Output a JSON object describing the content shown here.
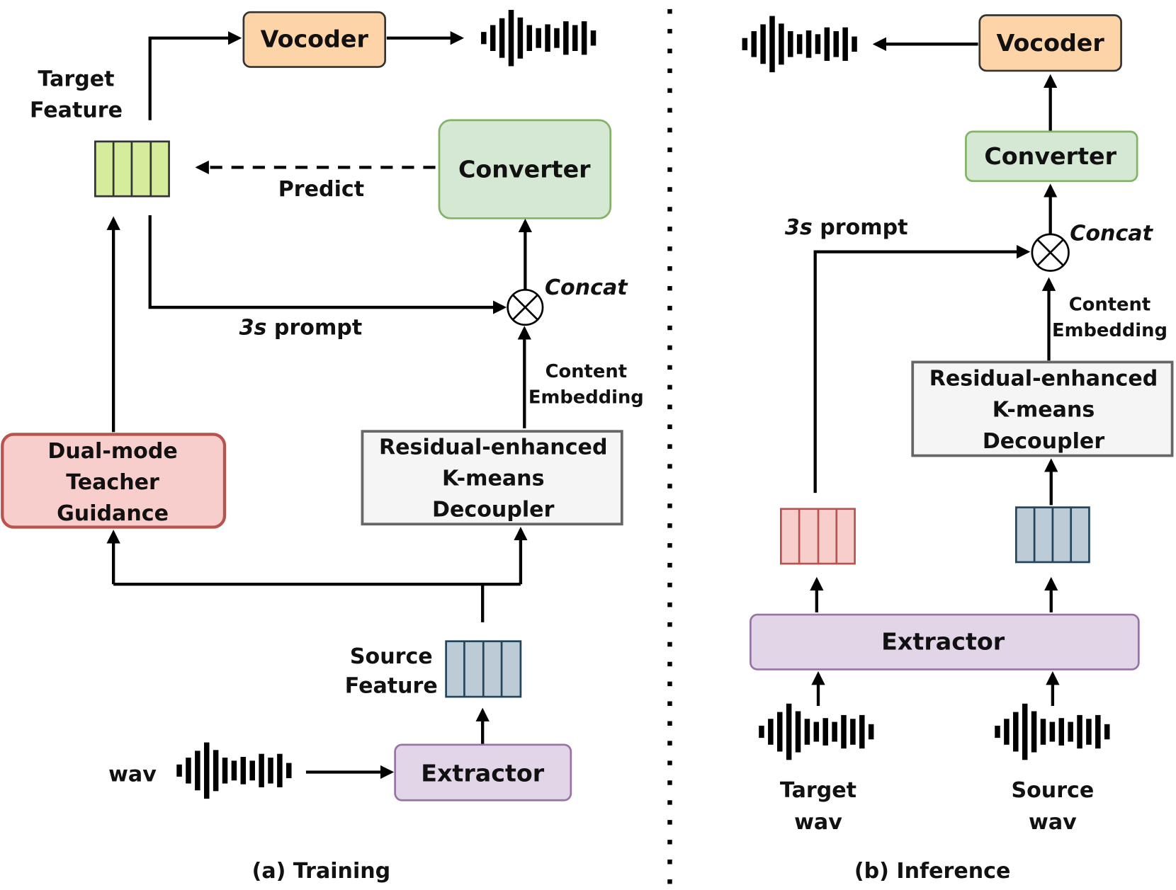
{
  "training": {
    "caption": "(a) Training",
    "vocoder": "Vocoder",
    "target_feature": [
      "Target",
      "Feature"
    ],
    "converter": "Converter",
    "predict": "Predict",
    "prompt_italic": "3s",
    "prompt_rest": " prompt",
    "concat": "Concat",
    "content_embedding": [
      "Content",
      "Embedding"
    ],
    "decoupler": [
      "Residual-enhanced",
      "K-means",
      "Decoupler"
    ],
    "teacher": [
      "Dual-mode",
      "Teacher",
      "Guidance"
    ],
    "source_feature": [
      "Source",
      "Feature"
    ],
    "extractor": "Extractor",
    "wav": "wav"
  },
  "inference": {
    "caption": "(b) Inference",
    "vocoder": "Vocoder",
    "converter": "Converter",
    "prompt_italic": "3s",
    "prompt_rest": " prompt",
    "concat": "Concat",
    "content_embedding": [
      "Content",
      "Embedding"
    ],
    "decoupler": [
      "Residual-enhanced",
      "K-means",
      "Decoupler"
    ],
    "extractor": "Extractor",
    "target_wav": [
      "Target",
      "wav"
    ],
    "source_wav": [
      "Source",
      "wav"
    ]
  },
  "colors": {
    "vocoder": "#fdd3a8",
    "converter": "#d5e8d4",
    "converter_stroke": "#82b366",
    "teacher": "#f8cecc",
    "teacher_stroke": "#b85450",
    "extractor": "#e1d5e7",
    "extractor_stroke": "#9673a6",
    "target_feature_fill": "#d4ec9c",
    "source_feature_fill": "#bccbd6",
    "source_feature_stroke": "#23445d"
  }
}
